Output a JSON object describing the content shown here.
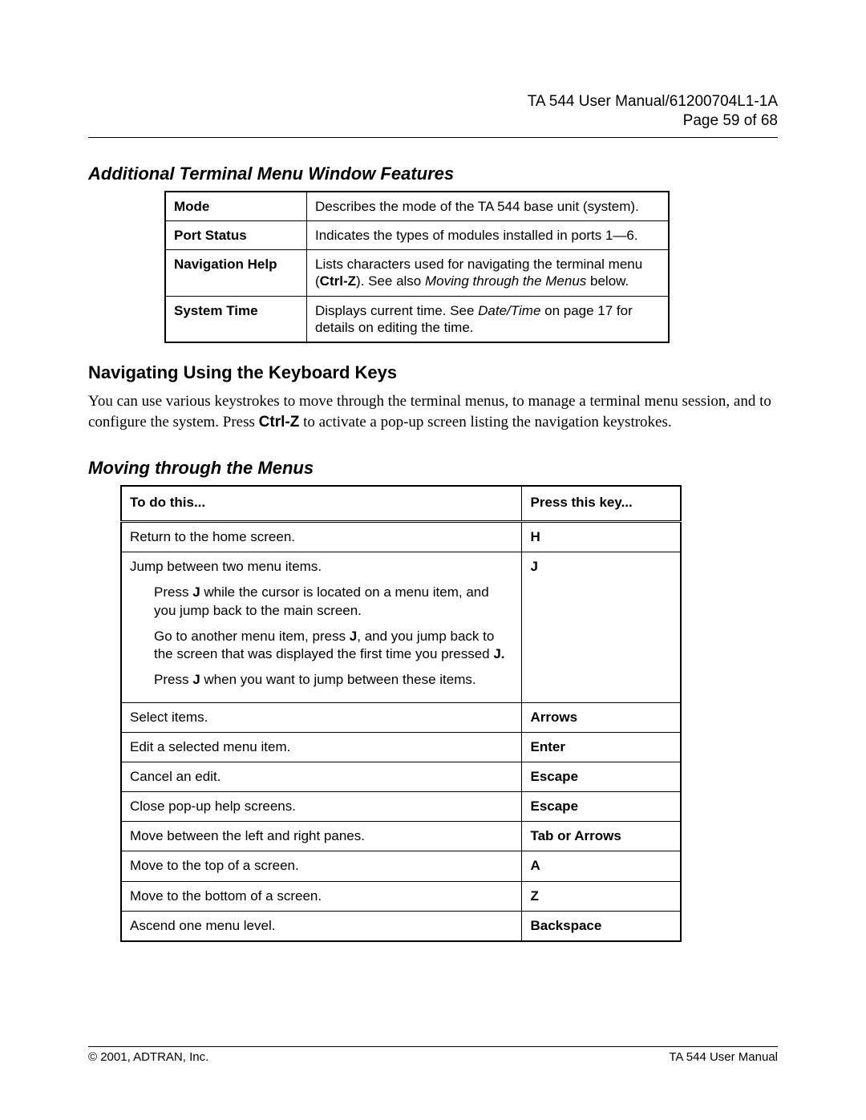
{
  "header": {
    "title": "TA 544 User Manual/61200704L1-1A",
    "page": "Page 59 of 68"
  },
  "sections": {
    "featuresHeading": "Additional Terminal Menu Window Features",
    "navHeading": "Navigating Using the Keyboard Keys",
    "navParagraph_part1": "You can use various keystrokes to move through the terminal menus, to manage a terminal menu session, and to configure the system. Press ",
    "navParagraph_ctrlz": "Ctrl-Z",
    "navParagraph_part2": " to activate a pop-up screen listing the navigation keystrokes.",
    "movingHeading": "Moving through the Menus"
  },
  "featureTable": {
    "rows": [
      {
        "label": "Mode",
        "desc_plain": "Describes the mode of the TA 544 base unit (system)."
      },
      {
        "label": "Port Status",
        "desc_plain": "Indicates the types of modules installed in ports 1—6."
      },
      {
        "label": "Navigation Help",
        "nav_p1": "Lists characters used for navigating the terminal menu (",
        "nav_b": "Ctrl-Z",
        "nav_p2": "). See also ",
        "nav_i": "Moving through the Menus",
        "nav_p3": " below."
      },
      {
        "label": "System Time",
        "sys_p1": "Displays current time. See ",
        "sys_i": "Date/Time",
        "sys_p2": " on page 17 for details on editing the time."
      }
    ]
  },
  "keyTable": {
    "headers": {
      "todo": "To do this...",
      "key": "Press this key..."
    },
    "r0": {
      "todo": "Return to the home screen.",
      "key": "H"
    },
    "r1": {
      "todo_main": "Jump between two menu items.",
      "p1a": "Press ",
      "p1b": "J",
      "p1c": " while the cursor is located on a menu item, and you jump back to the main screen.",
      "p2a": "Go to another menu item, press ",
      "p2b": "J",
      "p2c": ", and you jump back to the screen that was displayed the first time you pressed ",
      "p2d": "J.",
      "p3a": "Press ",
      "p3b": "J",
      "p3c": " when you want to jump between these items.",
      "key": "J"
    },
    "r2": {
      "todo": "Select items.",
      "key": "Arrows"
    },
    "r3": {
      "todo": "Edit a selected menu item.",
      "key": "Enter"
    },
    "r4": {
      "todo": "Cancel an edit.",
      "key": "Escape"
    },
    "r5": {
      "todo": "Close pop-up help screens.",
      "key": "Escape"
    },
    "r6": {
      "todo": "Move between the left and right panes.",
      "key": "Tab or Arrows"
    },
    "r7": {
      "todo": "Move to the top of a screen.",
      "key": "A"
    },
    "r8": {
      "todo": "Move to the bottom of a screen.",
      "key": "Z"
    },
    "r9": {
      "todo": "Ascend one menu level.",
      "key": "Backspace"
    }
  },
  "footer": {
    "left": "© 2001, ADTRAN, Inc.",
    "right": "TA 544 User Manual"
  }
}
